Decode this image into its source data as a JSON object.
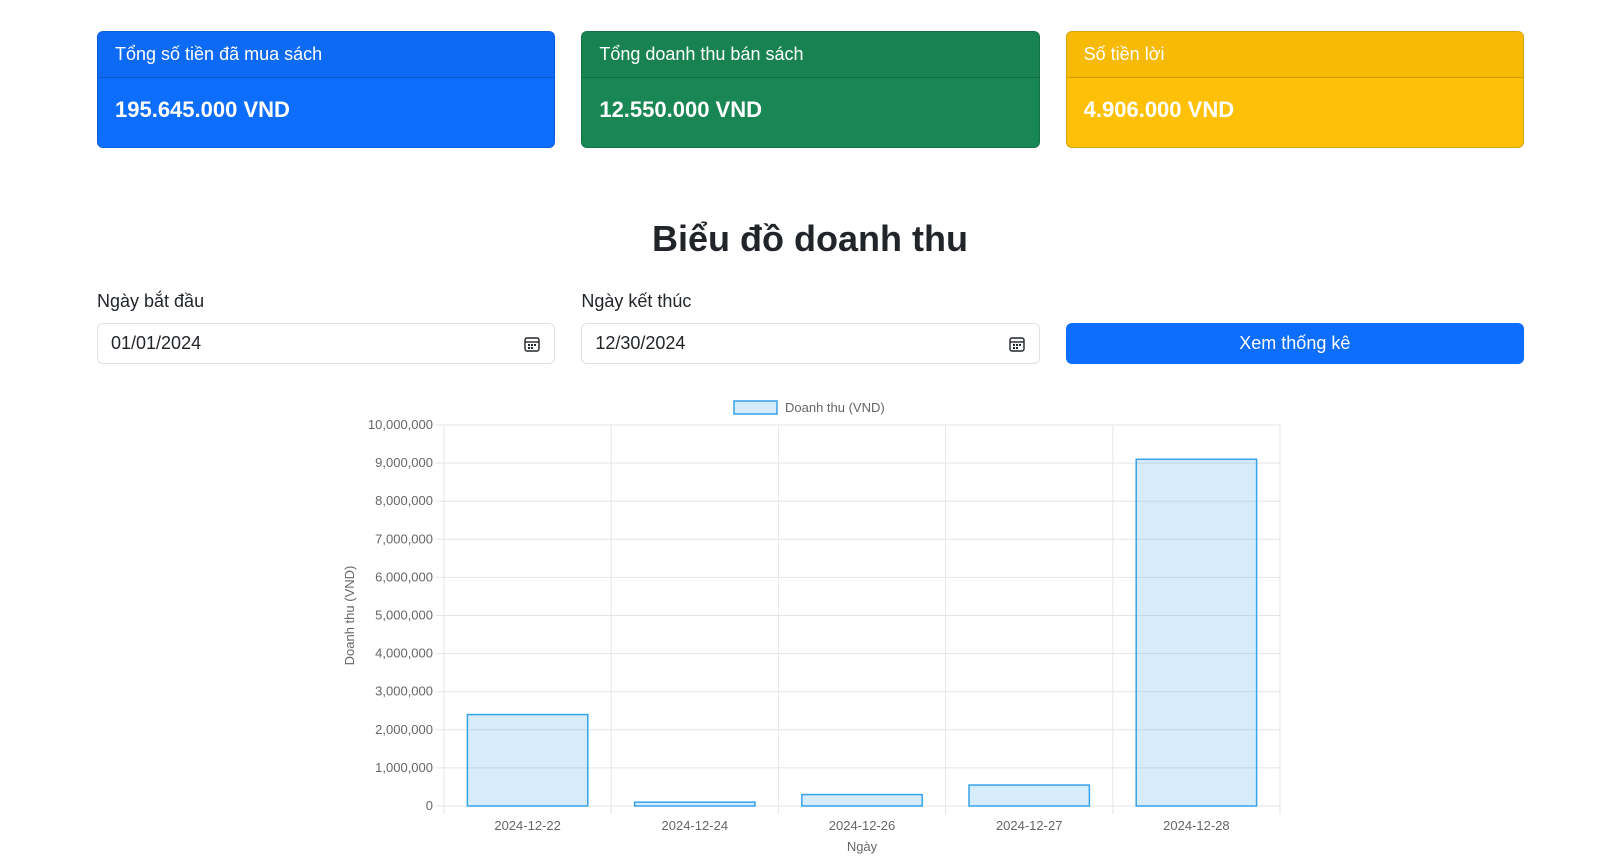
{
  "summary": {
    "cards": [
      {
        "title": "Tổng số tiền đã mua sách",
        "value": "195.645.000 VND",
        "color": "#0d6efd"
      },
      {
        "title": "Tổng doanh thu bán sách",
        "value": "12.550.000 VND",
        "color": "#198754"
      },
      {
        "title": "Số tiền lời",
        "value": "4.906.000 VND",
        "color": "#ffc107"
      }
    ]
  },
  "section": {
    "title": "Biểu đồ doanh thu"
  },
  "filters": {
    "start_label": "Ngày bắt đầu",
    "start_value": "01/01/2024",
    "end_label": "Ngày kết thúc",
    "end_value": "12/30/2024",
    "submit_label": "Xem thống kê",
    "calendar_icon": "calendar-icon"
  },
  "chart_data": {
    "type": "bar",
    "categories": [
      "2024-12-22",
      "2024-12-24",
      "2024-12-26",
      "2024-12-27",
      "2024-12-28"
    ],
    "series": [
      {
        "name": "Doanh thu (VND)",
        "values": [
          2400000,
          100000,
          300000,
          550000,
          9100000
        ],
        "color": "#36a2eb",
        "fill": "rgba(54,162,235,0.2)"
      }
    ],
    "ylabel": "Doanh thu (VND)",
    "xlabel": "Ngày",
    "ylim": [
      0,
      10000000
    ],
    "yticks": [
      "0",
      "1,000,000",
      "2,000,000",
      "3,000,000",
      "4,000,000",
      "5,000,000",
      "6,000,000",
      "7,000,000",
      "8,000,000",
      "9,000,000",
      "10,000,000"
    ],
    "legend_position": "top",
    "grid": true
  }
}
